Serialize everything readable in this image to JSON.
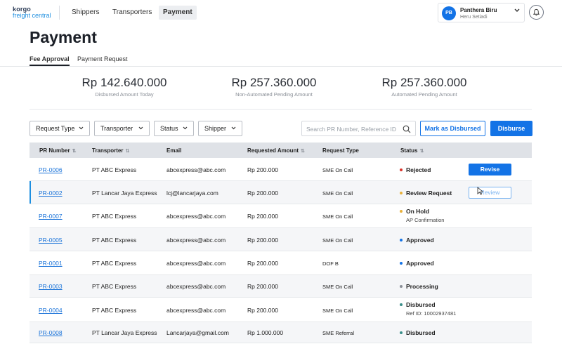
{
  "brand": {
    "line1": "korgo",
    "line2": "freight central"
  },
  "nav": [
    {
      "label": "Shippers"
    },
    {
      "label": "Transporters"
    },
    {
      "label": "Payment"
    }
  ],
  "user": {
    "initials": "PB",
    "name": "Panthera Biru",
    "company": "Heru Setiadi",
    "chevron_icon": "chevron-down-icon",
    "bell_icon": "bell-icon"
  },
  "page": {
    "title": "Payment"
  },
  "tabs": [
    {
      "label": "Fee Approval"
    },
    {
      "label": "Payment Request"
    }
  ],
  "summary": [
    {
      "amount": "Rp 142.640.000",
      "label": "Disbursed Amount Today"
    },
    {
      "amount": "Rp 257.360.000",
      "label": "Non-Automated Pending Amount"
    },
    {
      "amount": "Rp 257.360.000",
      "label": "Automated Pending Amount"
    }
  ],
  "filters": [
    {
      "label": "Request Type"
    },
    {
      "label": "Transporter"
    },
    {
      "label": "Status"
    },
    {
      "label": "Shipper"
    }
  ],
  "search": {
    "placeholder": "Search PR Number, Reference ID",
    "value": ""
  },
  "actions": {
    "mark_disbursed": "Mark as Disbursed",
    "disburse": "Disburse"
  },
  "table": {
    "headers": {
      "pr": "PR Number",
      "transporter": "Transporter",
      "email": "Email",
      "amount": "Requested Amount",
      "type": "Request Type",
      "status": "Status"
    },
    "rows": [
      {
        "pr": "PR-0006",
        "transporter": "PT ABC Express",
        "email": "abcexpress@abc.com",
        "amount": "Rp 200.000",
        "type": "SME On Call",
        "status": "Rejected",
        "status_color": "#d9342b",
        "sub": "",
        "action": "Revise",
        "action_style": "primary"
      },
      {
        "pr": "PR-0002",
        "transporter": "PT Lancar Jaya Express",
        "email": "lcj@lancarjaya.com",
        "amount": "Rp 200.000",
        "type": "SME On Call",
        "status": "Review Request",
        "status_color": "#e8b13a",
        "sub": "",
        "action": "Review",
        "action_style": "outline"
      },
      {
        "pr": "PR-0007",
        "transporter": "PT ABC Express",
        "email": "abcexpress@abc.com",
        "amount": "Rp 200.000",
        "type": "SME On Call",
        "status": "On Hold",
        "status_color": "#e8b13a",
        "sub": "AP Confirmation",
        "action": "",
        "action_style": ""
      },
      {
        "pr": "PR-0005",
        "transporter": "PT ABC Express",
        "email": "abcexpress@abc.com",
        "amount": "Rp 200.000",
        "type": "SME On Call",
        "status": "Approved",
        "status_color": "#1373e6",
        "sub": "",
        "action": "",
        "action_style": ""
      },
      {
        "pr": "PR-0001",
        "transporter": "PT ABC Express",
        "email": "abcexpress@abc.com",
        "amount": "Rp 200.000",
        "type": "DOF B",
        "status": "Approved",
        "status_color": "#1373e6",
        "sub": "",
        "action": "",
        "action_style": ""
      },
      {
        "pr": "PR-0003",
        "transporter": "PT ABC Express",
        "email": "abcexpress@abc.com",
        "amount": "Rp 200.000",
        "type": "SME On Call",
        "status": "Processing",
        "status_color": "#8a8f97",
        "sub": "",
        "action": "",
        "action_style": ""
      },
      {
        "pr": "PR-0004",
        "transporter": "PT ABC Express",
        "email": "abcexpress@abc.com",
        "amount": "Rp 200.000",
        "type": "SME On Call",
        "status": "Disbursed",
        "status_color": "#3a8f8a",
        "sub": "Ref ID: 10002937481",
        "action": "",
        "action_style": ""
      },
      {
        "pr": "PR-0008",
        "transporter": "PT Lancar Jaya Express",
        "email": "Lancarjaya@gmail.com",
        "amount": "Rp 1.000.000",
        "type": "SME Referral",
        "status": "Disbursed",
        "status_color": "#3a8f8a",
        "sub": "",
        "action": "",
        "action_style": ""
      }
    ]
  }
}
